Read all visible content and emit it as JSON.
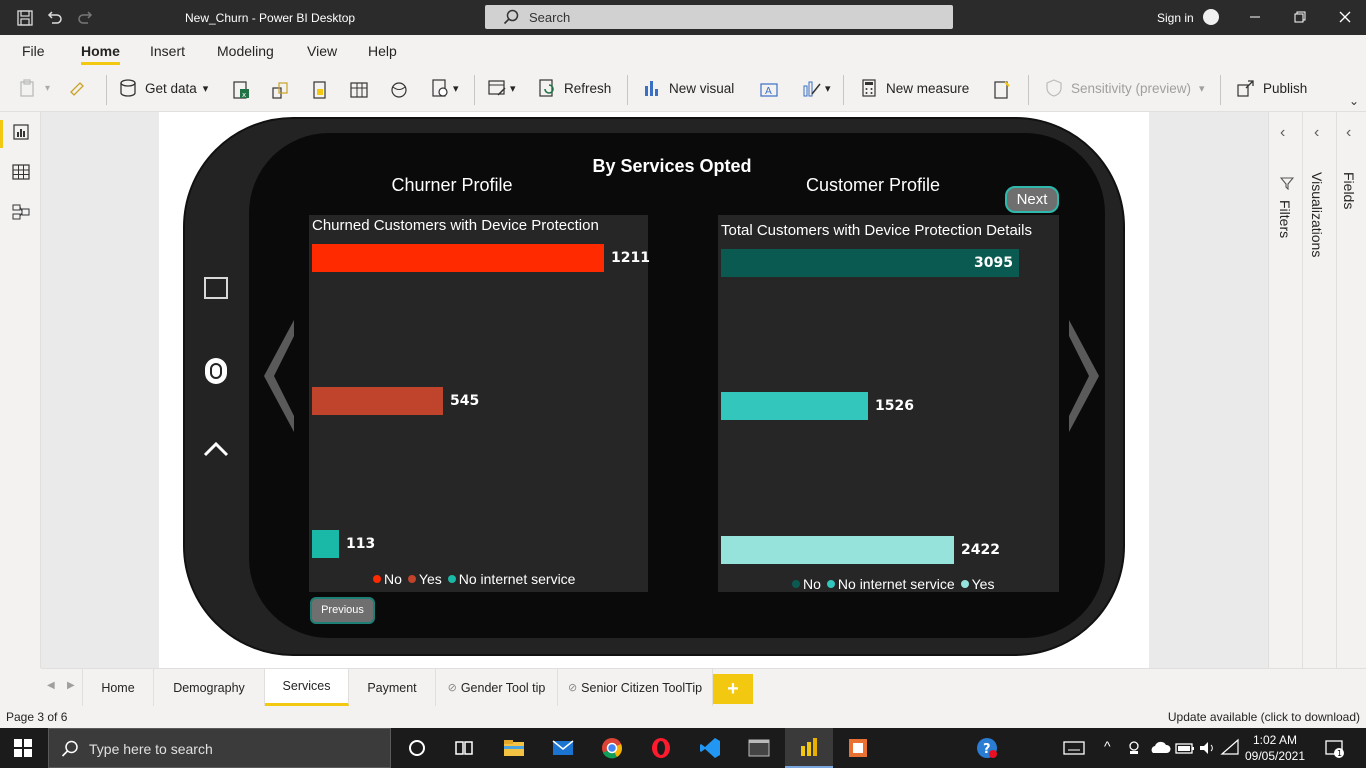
{
  "window": {
    "title": "New_Churn - Power BI Desktop",
    "search_placeholder": "Search",
    "sign_in": "Sign in"
  },
  "menu": {
    "items": [
      "File",
      "Home",
      "Insert",
      "Modeling",
      "View",
      "Help"
    ],
    "active": "Home"
  },
  "ribbon": {
    "get_data": "Get data",
    "refresh": "Refresh",
    "new_visual": "New visual",
    "new_measure": "New measure",
    "sensitivity": "Sensitivity (preview)",
    "publish": "Publish"
  },
  "report": {
    "title": "By Services Opted",
    "left_section": "Churner Profile",
    "right_section": "Customer Profile",
    "next_label": "Next",
    "previous_label": "Previous"
  },
  "chart_data": [
    {
      "type": "bar",
      "title": "Churned Customers with Device Protection",
      "categories": [
        "No",
        "Yes",
        "No internet service"
      ],
      "values": [
        1211,
        545,
        113
      ],
      "colors": [
        "#ff2a00",
        "#c0432b",
        "#1ab8a6"
      ],
      "legend": [
        "No",
        "Yes",
        "No internet service"
      ],
      "legend_colors": [
        "#ff2a00",
        "#c0432b",
        "#1ab8a6"
      ],
      "legend_position": "bottom"
    },
    {
      "type": "bar",
      "title": "Total Customers with Device Protection Details",
      "categories": [
        "No",
        "No internet service",
        "Yes"
      ],
      "values": [
        3095,
        1526,
        2422
      ],
      "colors": [
        "#0a5a52",
        "#33c6bd",
        "#96e3dc"
      ],
      "legend": [
        "No",
        "No internet service",
        "Yes"
      ],
      "legend_colors": [
        "#0a5a52",
        "#33c6bd",
        "#96e3dc"
      ],
      "legend_position": "bottom"
    }
  ],
  "panes": {
    "filters": "Filters",
    "visualizations": "Visualizations",
    "fields": "Fields"
  },
  "page_tabs": {
    "items": [
      "Home",
      "Demography",
      "Services",
      "Payment",
      "Gender Tool tip",
      "Senior Citizen ToolTip"
    ],
    "active": "Services",
    "add": "+"
  },
  "status": {
    "page": "Page 3 of 6",
    "update": "Update available (click to download)"
  },
  "taskbar": {
    "search_placeholder": "Type here to search",
    "time": "1:02 AM",
    "date": "09/05/2021"
  },
  "colors": {
    "accent": "#f2c811",
    "titlebar": "#2b2b2b",
    "teal": "#2fb8ac"
  }
}
